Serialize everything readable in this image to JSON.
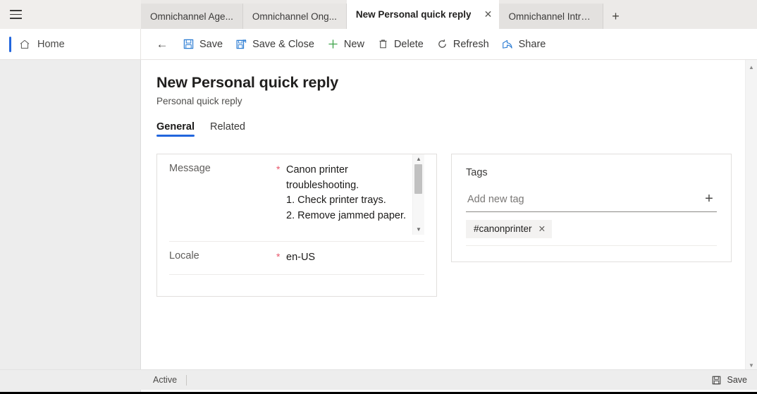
{
  "browser": {
    "menu_icon": "hamburger-icon",
    "tabs": [
      {
        "label": "Omnichannel Age...",
        "active": false
      },
      {
        "label": "Omnichannel Ong...",
        "active": false
      },
      {
        "label": "New Personal quick reply",
        "active": true,
        "close_icon": "✕"
      },
      {
        "label": "Omnichannel Intra...",
        "active": false
      }
    ],
    "new_tab_icon": "+"
  },
  "nav": {
    "home_label": "Home",
    "home_icon": "home-icon",
    "accent_color": "#2266dd"
  },
  "toolbar": {
    "back_icon": "←",
    "items": [
      {
        "label": "Save",
        "icon": "save-icon",
        "color": "#2b7cd3"
      },
      {
        "label": "Save & Close",
        "icon": "save-and-close-icon",
        "color": "#2b7cd3"
      },
      {
        "label": "New",
        "icon": "plus-icon",
        "color": "#3fa34a"
      },
      {
        "label": "Delete",
        "icon": "trash-icon",
        "color": "#4a4947"
      },
      {
        "label": "Refresh",
        "icon": "refresh-icon",
        "color": "#4a4947"
      },
      {
        "label": "Share",
        "icon": "share-icon",
        "color": "#2b7cd3"
      }
    ]
  },
  "form": {
    "title": "New Personal quick reply",
    "subtitle": "Personal quick reply",
    "tabs": [
      {
        "label": "General",
        "selected": true
      },
      {
        "label": "Related",
        "selected": false
      }
    ],
    "fields": {
      "message": {
        "label": "Message",
        "required": "*",
        "value": "Canon printer troubleshooting.\n1. Check printer trays.\n2. Remove jammed paper."
      },
      "locale": {
        "label": "Locale",
        "required": "*",
        "value": "en-US"
      }
    },
    "tags": {
      "title": "Tags",
      "input_placeholder": "Add new tag",
      "input_value": "",
      "add_icon": "+",
      "chips": [
        {
          "label": "#canonprinter",
          "remove_icon": "✕"
        }
      ]
    }
  },
  "statusbar": {
    "state": "Active",
    "save_label": "Save",
    "save_icon": "save-icon"
  },
  "scrollbars": {
    "up_arrow": "▲",
    "down_arrow": "▼"
  }
}
